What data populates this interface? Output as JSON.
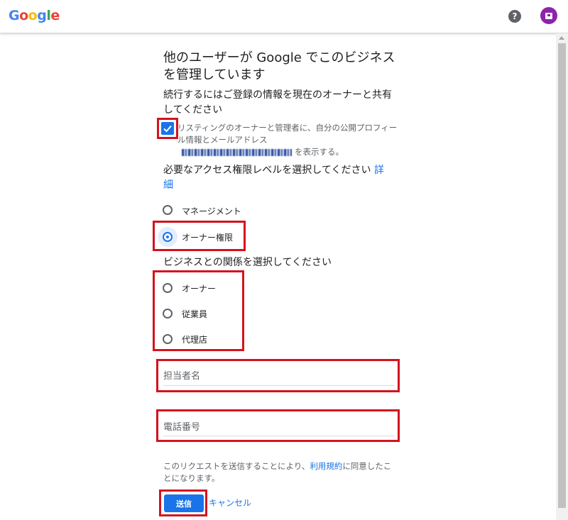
{
  "header": {
    "logo_letters": [
      {
        "char": "G",
        "color": "#4285F4"
      },
      {
        "char": "o",
        "color": "#EA4335"
      },
      {
        "char": "o",
        "color": "#FBBC05"
      },
      {
        "char": "g",
        "color": "#4285F4"
      },
      {
        "char": "l",
        "color": "#34A853"
      },
      {
        "char": "e",
        "color": "#EA4335"
      }
    ],
    "help_icon": "help-circle-icon",
    "help_symbol": "?",
    "avatar_color": "#8E24AA"
  },
  "main": {
    "title": "他のユーザーが Google でこのビジネスを管理しています",
    "share_heading": "続行するにはご登録の情報を現在のオーナーと共有してください",
    "consent": {
      "checked": true,
      "text_before": "リスティングのオーナーと管理者に、自分の公開プロフィール情報とメールアドレス",
      "text_after": "を表示する。"
    },
    "access_heading": "必要なアクセス権限レベルを選択してください",
    "access_link": "詳細",
    "access_options": [
      {
        "label": "マネージメント",
        "selected": false
      },
      {
        "label": "オーナー権限",
        "selected": true
      }
    ],
    "relation_heading": "ビジネスとの関係を選択してください",
    "relation_options": [
      {
        "label": "オーナー",
        "selected": false
      },
      {
        "label": "従業員",
        "selected": false
      },
      {
        "label": "代理店",
        "selected": false
      }
    ],
    "name_field": {
      "placeholder": "担当者名",
      "value": ""
    },
    "phone_field": {
      "placeholder": "電話番号",
      "value": ""
    },
    "terms_before": "このリクエストを送信することにより、",
    "terms_link": "利用規約",
    "terms_after": "に同意したことになります。",
    "submit_label": "送信",
    "cancel_label": "キャンセル"
  },
  "colors": {
    "accent": "#1A73E8",
    "highlight": "#D3131F"
  }
}
